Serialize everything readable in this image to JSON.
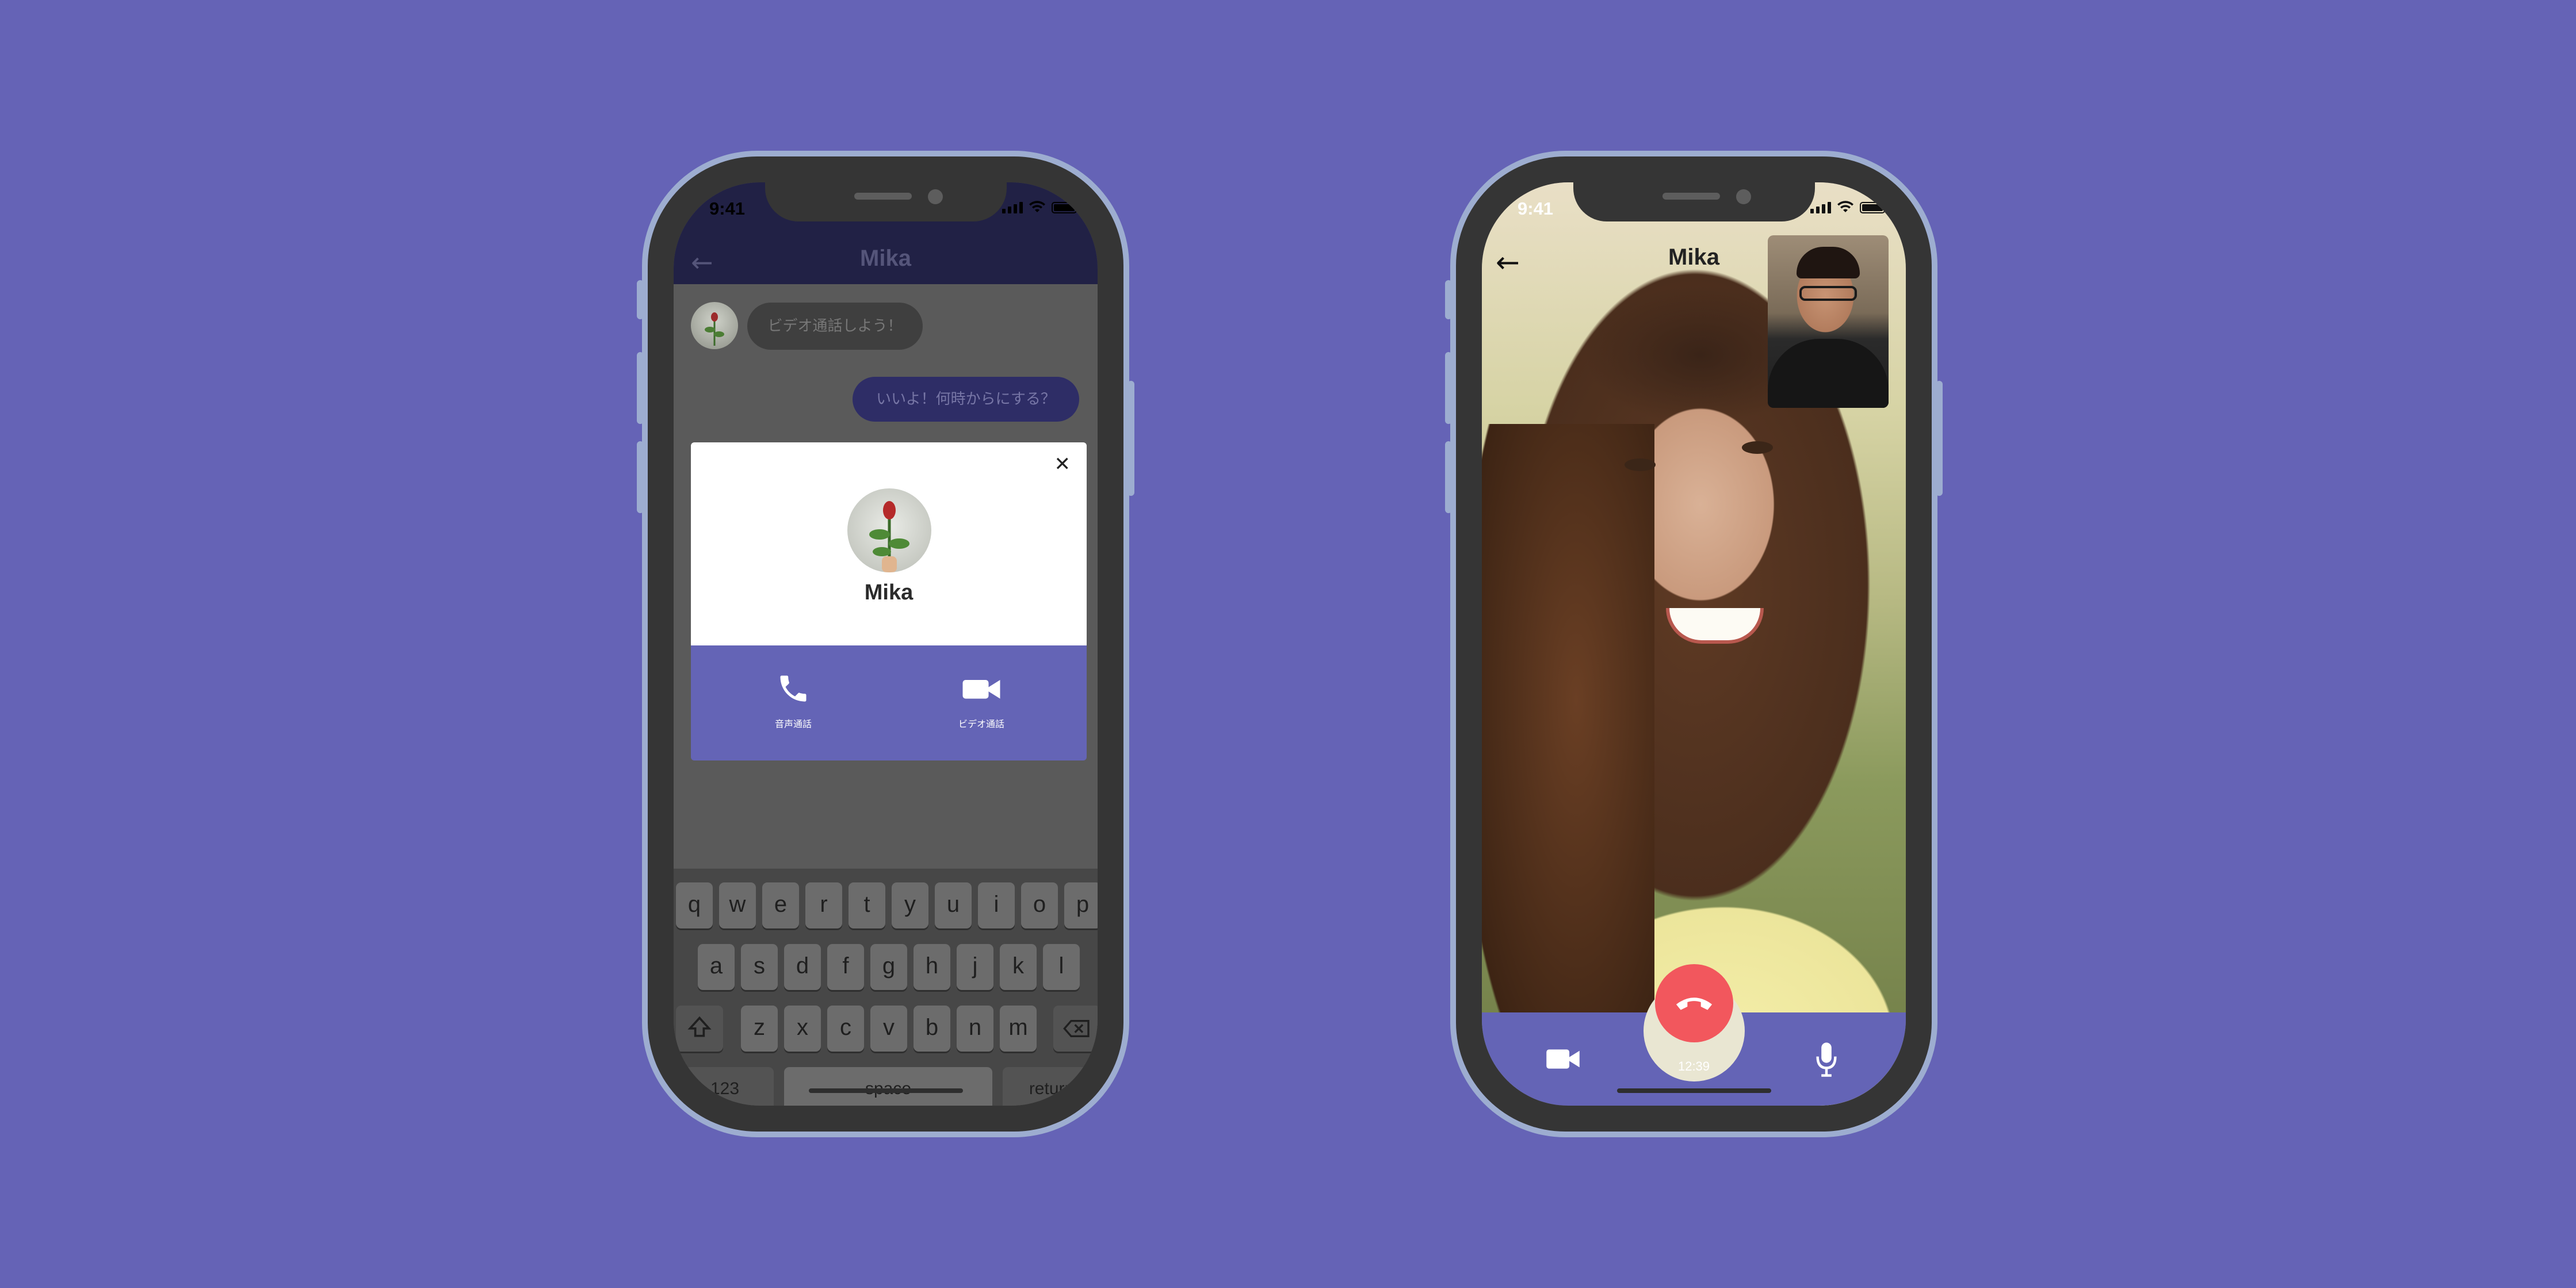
{
  "colors": {
    "background": "#6563b6",
    "accent": "#6464b6",
    "end_call": "#f2575d"
  },
  "left_phone": {
    "status": {
      "time": "9:41"
    },
    "header": {
      "back_icon": "arrow-left-icon",
      "title": "Mika"
    },
    "chat": {
      "incoming_message": "ビデオ通話しよう！",
      "outgoing_message": "いいよ！何時からにする？"
    },
    "call_modal": {
      "close_icon": "close-icon",
      "contact_name": "Mika",
      "actions": [
        {
          "icon": "phone-icon",
          "label": "音声通話"
        },
        {
          "icon": "video-camera-icon",
          "label": "ビデオ通話"
        }
      ]
    },
    "keyboard": {
      "row1": [
        "q",
        "w",
        "e",
        "r",
        "t",
        "y",
        "u",
        "i",
        "o",
        "p"
      ],
      "row2": [
        "a",
        "s",
        "d",
        "f",
        "g",
        "h",
        "j",
        "k",
        "l"
      ],
      "row3": [
        "z",
        "x",
        "c",
        "v",
        "b",
        "n",
        "m"
      ],
      "numbers_key": "123",
      "space_key": "space",
      "return_key": "return"
    }
  },
  "right_phone": {
    "status": {
      "time": "9:41"
    },
    "header": {
      "back_icon": "arrow-left-icon",
      "title": "Mika"
    },
    "call": {
      "duration": "12:39"
    }
  }
}
